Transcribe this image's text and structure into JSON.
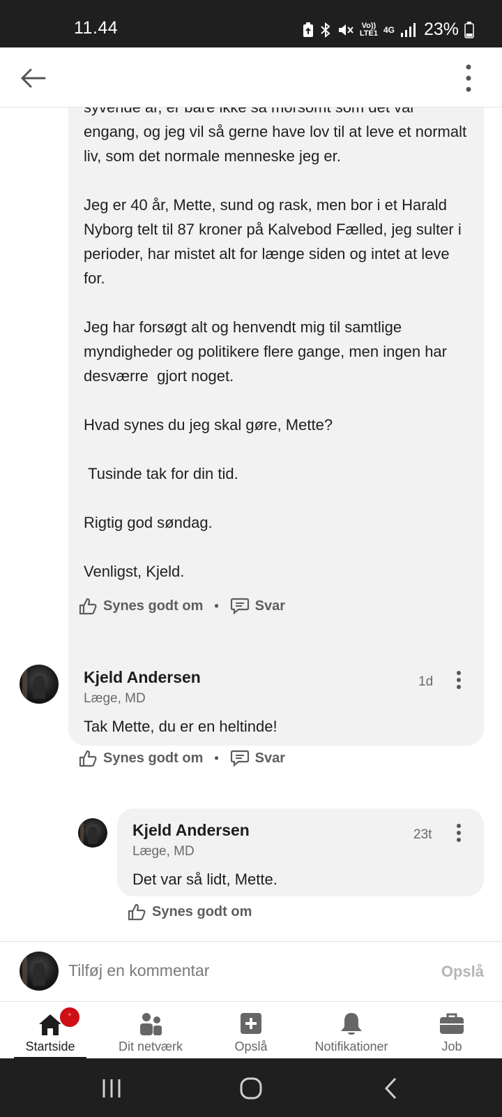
{
  "status_bar": {
    "time": "11.44",
    "network_label": "Vo))\nLTE1",
    "network_gen": "4G",
    "battery": "23%"
  },
  "post": {
    "paragraphs": [
      "syvende år, er bare ikke så morsomt som det var engang, og jeg vil så gerne have lov til at leve et normalt liv, som det normale menneske jeg er.",
      "Jeg er 40 år, Mette, sund og rask, men bor i et Harald Nyborg telt til 87 kroner på Kalvebod Fælled, jeg sulter i perioder, har mistet alt for længe siden og intet at leve for.",
      "Jeg har forsøgt alt og henvendt mig til samtlige myndigheder og politikere flere gange, men ingen har desværre  gjort noget.",
      "Hvad synes du jeg skal gøre, Mette?",
      " Tusinde tak for din tid.",
      "Rigtig god søndag.",
      "Venligst, Kjeld."
    ],
    "like_label": "Synes godt om",
    "reply_label": "Svar",
    "separator": "•"
  },
  "comments": [
    {
      "name": "Kjeld Andersen",
      "subtitle": "Læge, MD",
      "time": "1d",
      "text": "Tak Mette, du er en heltinde!",
      "like_label": "Synes godt om",
      "reply_label": "Svar",
      "separator": "•"
    },
    {
      "name": "Kjeld Andersen",
      "subtitle": "Læge, MD",
      "time": "23t",
      "text": "Det var så lidt, Mette.",
      "like_label": "Synes godt om"
    }
  ],
  "comment_input": {
    "placeholder": "Tilføj en kommentar",
    "post_label": "Opslå"
  },
  "bottom_nav": {
    "items": [
      {
        "label": "Startside",
        "icon": "home-icon",
        "active": true,
        "badge": "°"
      },
      {
        "label": "Dit netværk",
        "icon": "people-icon"
      },
      {
        "label": "Opslå",
        "icon": "plus-square-icon"
      },
      {
        "label": "Notifikationer",
        "icon": "bell-icon"
      },
      {
        "label": "Job",
        "icon": "briefcase-icon"
      }
    ]
  },
  "colors": {
    "badge": "#cc1016",
    "bubble": "#f2f2f2",
    "system_bar": "#1f1f1f"
  }
}
